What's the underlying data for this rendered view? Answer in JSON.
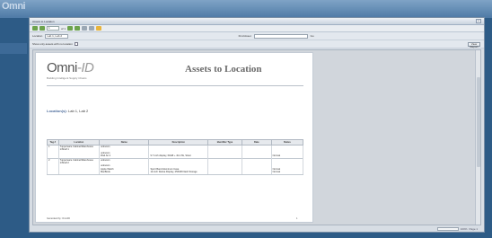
{
  "desktop": {
    "logo": "Omni",
    "side_label": "",
    "right_text": ""
  },
  "window": {
    "title": "Assets to Location",
    "close_label": "x"
  },
  "toolbar": {
    "page_current": "1",
    "page_of": "of 1"
  },
  "params": {
    "location_label": "Location",
    "location_value": "Lab 1, Lab 2",
    "search_label": "Find Asset",
    "search_button": "Go"
  },
  "options": {
    "label": "Show only assets with no location",
    "view_button": "View Report"
  },
  "report": {
    "logo_main": "Omni",
    "logo_id": "-ID",
    "tagline": "Building Intelligent Supply Chains",
    "title": "Assets to Location",
    "location_label": "Location(s):",
    "location_value": "Lab 1, Lab 2",
    "columns": [
      "Tag #",
      "Location",
      "Name",
      "Description",
      "Identifier Type",
      "Date",
      "Status"
    ],
    "rows": [
      {
        "tag": "1",
        "location": "Tupperware Cabinet/Warehouse 1/Shelf 1",
        "names": [
          "unknown",
          "unknown",
          "iPad Air 2"
        ],
        "descriptions": [
          "",
          "",
          "9.7 inch display, 64GB + 4G LTE, Silver"
        ],
        "identifier": "",
        "date": "",
        "statuses": [
          "",
          "",
          "Normal"
        ]
      },
      {
        "tag": "2",
        "location": "Tupperware Cabinet/Warehouse 1/Shelf 2",
        "names": [
          "unknown",
          "unknown",
          "Apple Watch",
          "MacBook"
        ],
        "descriptions": [
          "",
          "",
          "Sport Band Aluminum Case",
          "12-inch Retina Display, 256GB Flash Storage"
        ],
        "identifier": "",
        "date": "",
        "statuses": [
          "",
          "",
          "Normal",
          "Normal"
        ]
      }
    ],
    "footer_left": "Generated by: OmniID",
    "footer_right": "1"
  },
  "statusbar": {
    "zoom": "100%",
    "page": "Page 1"
  }
}
